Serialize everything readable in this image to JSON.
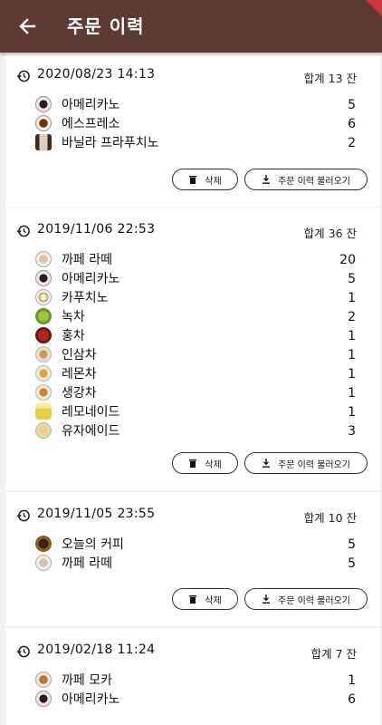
{
  "header": {
    "title": "주문 이력",
    "back_icon": "arrow-left-icon"
  },
  "colors": {
    "appbar": "#5d3a34",
    "accent": "#c43a3a"
  },
  "buttons": {
    "delete": "삭제",
    "load": "주문 이력 불러오기"
  },
  "orders": [
    {
      "datetime": "2020/08/23 14:13",
      "total": "합계 13 잔",
      "items": [
        {
          "name": "아메리카노",
          "qty": "5",
          "icon": "americano-icon"
        },
        {
          "name": "에스프레소",
          "qty": "6",
          "icon": "espresso-icon"
        },
        {
          "name": "바닐라 프라푸치노",
          "qty": "2",
          "icon": "frappuccino-icon"
        }
      ]
    },
    {
      "datetime": "2019/11/06 22:53",
      "total": "합계 36 잔",
      "items": [
        {
          "name": "까페 라떼",
          "qty": "20",
          "icon": "latte-icon"
        },
        {
          "name": "아메리카노",
          "qty": "5",
          "icon": "americano-icon"
        },
        {
          "name": "카푸치노",
          "qty": "1",
          "icon": "cappuccino-icon"
        },
        {
          "name": "녹차",
          "qty": "2",
          "icon": "green-tea-icon"
        },
        {
          "name": "홍차",
          "qty": "1",
          "icon": "black-tea-icon"
        },
        {
          "name": "인삼차",
          "qty": "1",
          "icon": "ginseng-tea-icon"
        },
        {
          "name": "레몬차",
          "qty": "1",
          "icon": "lemon-tea-icon"
        },
        {
          "name": "생강차",
          "qty": "1",
          "icon": "ginger-tea-icon"
        },
        {
          "name": "레모네이드",
          "qty": "1",
          "icon": "lemonade-icon"
        },
        {
          "name": "유자에이드",
          "qty": "3",
          "icon": "yuja-ade-icon"
        }
      ]
    },
    {
      "datetime": "2019/11/05 23:55",
      "total": "합계 10 잔",
      "items": [
        {
          "name": "오늘의 커피",
          "qty": "5",
          "icon": "daily-coffee-icon"
        },
        {
          "name": "까페 라떼",
          "qty": "5",
          "icon": "latte-icon"
        }
      ]
    },
    {
      "datetime": "2019/02/18 11:24",
      "total": "합계 7 잔",
      "items": [
        {
          "name": "까페 모카",
          "qty": "1",
          "icon": "mocha-icon"
        },
        {
          "name": "아메리카노",
          "qty": "6",
          "icon": "americano-icon"
        }
      ]
    }
  ]
}
